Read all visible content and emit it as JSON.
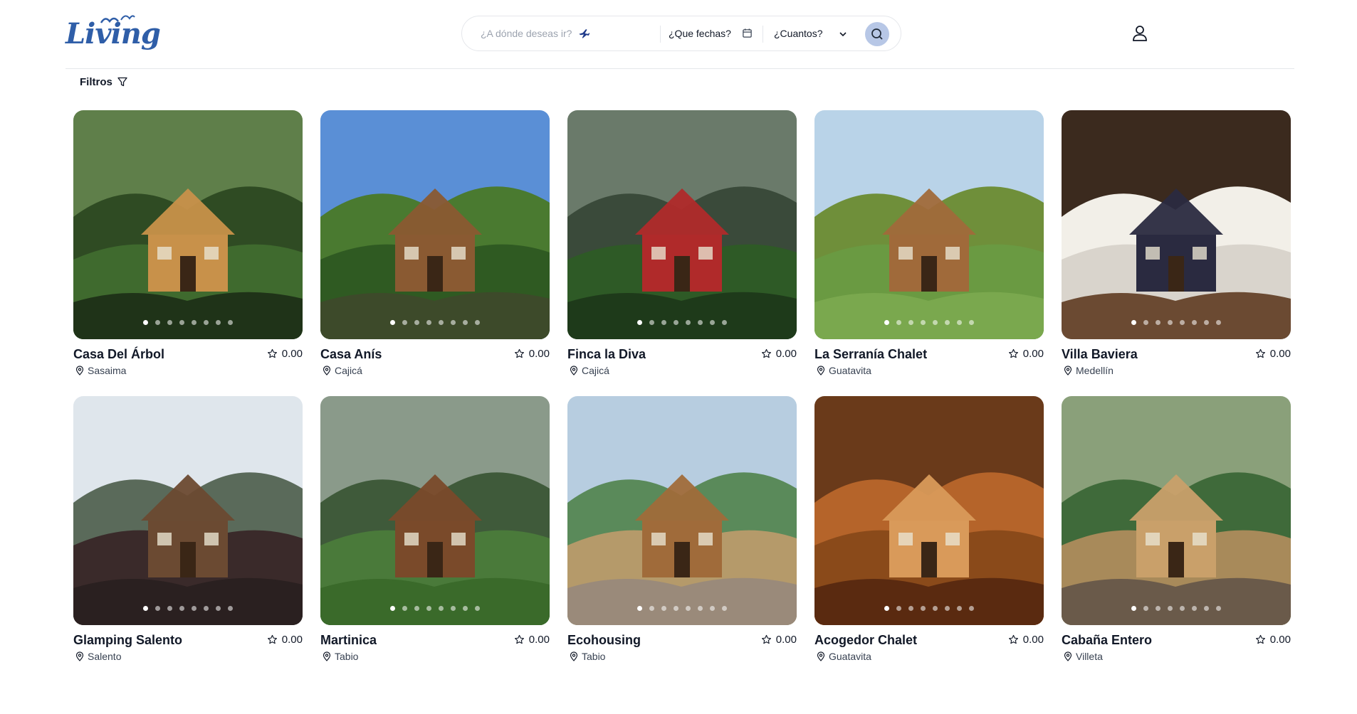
{
  "header": {
    "logo_text": "Living",
    "search": {
      "where_placeholder": "¿A dónde deseas ir?",
      "dates_label": "¿Que fechas?",
      "guests_label": "¿Cuantos?"
    }
  },
  "filters": {
    "label": "Filtros"
  },
  "colors": {
    "brand": "#2f5ea8",
    "search_button": "#b7c7e6",
    "divider": "#e5e7eb"
  },
  "listings": [
    {
      "title": "Casa Del Árbol",
      "rating": "0.00",
      "location": "Sasaima"
    },
    {
      "title": "Casa Anís",
      "rating": "0.00",
      "location": "Cajicá"
    },
    {
      "title": "Finca la Diva",
      "rating": "0.00",
      "location": "Cajicá"
    },
    {
      "title": "La Serranía Chalet",
      "rating": "0.00",
      "location": "Guatavita"
    },
    {
      "title": "Villa Baviera",
      "rating": "0.00",
      "location": "Medellín"
    },
    {
      "title": "Glamping Salento",
      "rating": "0.00",
      "location": "Salento"
    },
    {
      "title": "Martinica",
      "rating": "0.00",
      "location": "Tabio"
    },
    {
      "title": "Ecohousing",
      "rating": "0.00",
      "location": "Tabio"
    },
    {
      "title": "Acogedor Chalet",
      "rating": "0.00",
      "location": "Guatavita"
    },
    {
      "title": "Cabaña Entero",
      "rating": "0.00",
      "location": "Villeta"
    }
  ]
}
